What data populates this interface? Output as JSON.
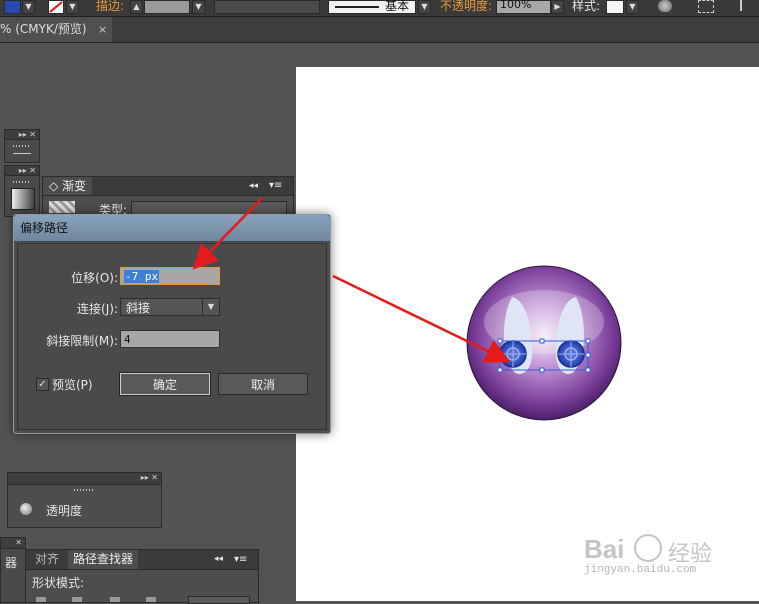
{
  "toolbar": {
    "stroke_label": "描边:",
    "stroke_style_label": "基本",
    "opacity_label": "不透明度:",
    "opacity_value": "100%",
    "style_label": "样式:"
  },
  "document_tab": {
    "title": "% (CMYK/预览)",
    "close": "×"
  },
  "gradient_panel": {
    "tab_label": "渐变",
    "type_label": "类型:"
  },
  "offset_dialog": {
    "title": "偏移路径",
    "offset_label": "位移(O):",
    "offset_value": "-7 px",
    "join_label": "连接(J):",
    "join_value": "斜接",
    "miter_label": "斜接限制(M):",
    "miter_value": "4",
    "preview_label": "预览(P)",
    "preview_checked": true,
    "ok_label": "确定",
    "cancel_label": "取消"
  },
  "transparency_panel": {
    "label": "透明度"
  },
  "pathfinder_panel": {
    "tab_align": "对齐",
    "tab_pathfinder": "路径查找器",
    "shape_modes_label": "形状模式:"
  },
  "left_edge": {
    "label": "器"
  },
  "watermark": {
    "brand": "Bai",
    "brand_suffix": "经验",
    "url": "jingyan.baidu.com"
  },
  "colors": {
    "app_bg": "#535353",
    "artboard": "#ffffff",
    "annotation_arrow": "#e31b1b",
    "orb_purple": "#7b3e9a",
    "selection_blue": "#2d5fd8"
  }
}
